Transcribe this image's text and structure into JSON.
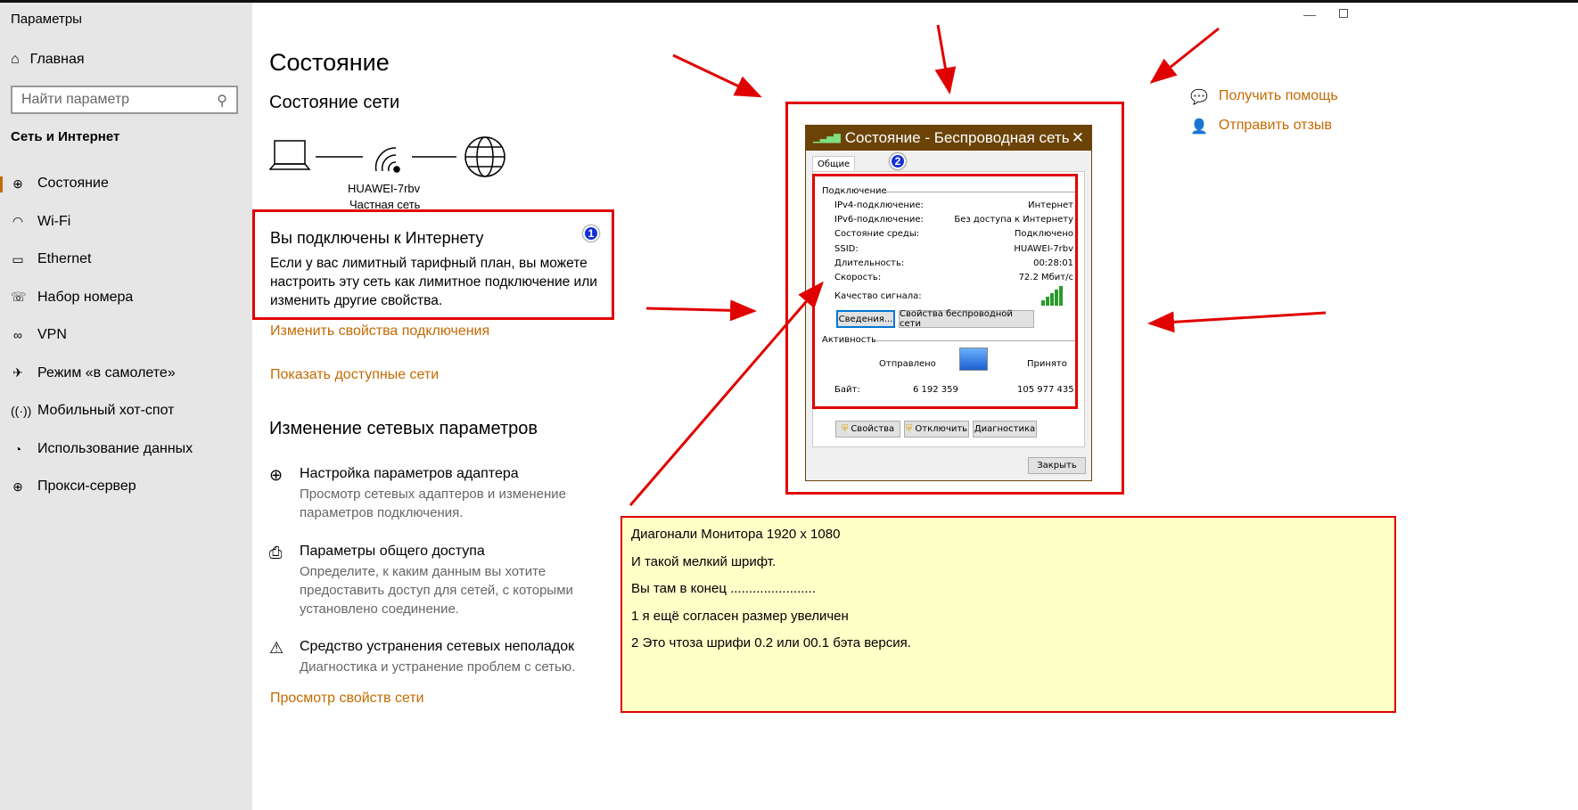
{
  "window": {
    "title": "Параметры",
    "controls": [
      "minimize",
      "maximize"
    ]
  },
  "sidebar": {
    "home": "Главная",
    "search_placeholder": "Найти параметр",
    "section": "Сеть и Интернет",
    "items": [
      {
        "label": "Состояние",
        "icon": "globe-icon",
        "active": true
      },
      {
        "label": "Wi-Fi",
        "icon": "wifi-icon"
      },
      {
        "label": "Ethernet",
        "icon": "ethernet-icon"
      },
      {
        "label": "Набор номера",
        "icon": "dialup-icon"
      },
      {
        "label": "VPN",
        "icon": "vpn-icon"
      },
      {
        "label": "Режим «в самолете»",
        "icon": "airplane-icon"
      },
      {
        "label": "Мобильный хот-спот",
        "icon": "hotspot-icon"
      },
      {
        "label": "Использование данных",
        "icon": "data-usage-icon"
      },
      {
        "label": "Прокси-сервер",
        "icon": "proxy-icon"
      }
    ]
  },
  "main": {
    "title": "Состояние",
    "network_status": "Состояние сети",
    "network_name": "HUAWEI-7rbv",
    "network_type": "Частная сеть",
    "connected_title": "Вы подключены к Интернету",
    "connected_desc": "Если у вас лимитный тарифный план, вы можете настроить эту сеть как лимитное подключение или изменить другие свойства.",
    "change_props": "Изменить свойства подключения",
    "show_networks": "Показать доступные сети",
    "change_settings": "Изменение сетевых параметров",
    "options": [
      {
        "title": "Настройка параметров адаптера",
        "desc": "Просмотр сетевых адаптеров и изменение параметров подключения."
      },
      {
        "title": "Параметры общего доступа",
        "desc": "Определите, к каким данным вы хотите предоставить доступ для сетей, с которыми установлено соединение."
      },
      {
        "title": "Средство устранения сетевых неполадок",
        "desc": "Диагностика и устранение проблем с сетью."
      }
    ],
    "view_props": "Просмотр свойств сети"
  },
  "help": {
    "get_help": "Получить помощь",
    "feedback": "Отправить отзыв"
  },
  "dialog": {
    "title": "Состояние - Беспроводная сеть",
    "tab": "Общие",
    "connection": "Подключение",
    "rows": [
      {
        "k": "IPv4-подключение:",
        "v": "Интернет"
      },
      {
        "k": "IPv6-подключение:",
        "v": "Без доступа к Интернету"
      },
      {
        "k": "Состояние среды:",
        "v": "Подключено"
      },
      {
        "k": "SSID:",
        "v": "HUAWEI-7rbv"
      },
      {
        "k": "Длительность:",
        "v": "00:28:01"
      },
      {
        "k": "Скорость:",
        "v": "72.2 Мбит/с"
      }
    ],
    "signal": "Качество сигнала:",
    "signal_level": 5,
    "details_btn": "Сведения...",
    "wireless_btn": "Свойства беспроводной сети",
    "activity": "Активность",
    "sent": "Отправлено",
    "received": "Принято",
    "bytes": "Байт:",
    "bytes_sent": "6 192 359",
    "bytes_received": "105 977 435",
    "props_btn": "Свойства",
    "disable_btn": "Отключить",
    "diag_btn": "Диагностика",
    "close_btn": "Закрыть"
  },
  "badges": [
    "1",
    "2"
  ],
  "note": {
    "lines": [
      "Диагонали Монитора 1920 x 1080",
      "И такой мелкий шрифт.",
      "Вы там в конец .......................",
      "1 я ещё согласен размер увеличен",
      "2 Это чтоза шрифи 0.2 или 00.1 бэта версия."
    ]
  },
  "colors": {
    "accent": "#c46a00",
    "annotation": "#e00000",
    "note_bg": "#ffffc8",
    "dialog_title": "#6b4308"
  }
}
